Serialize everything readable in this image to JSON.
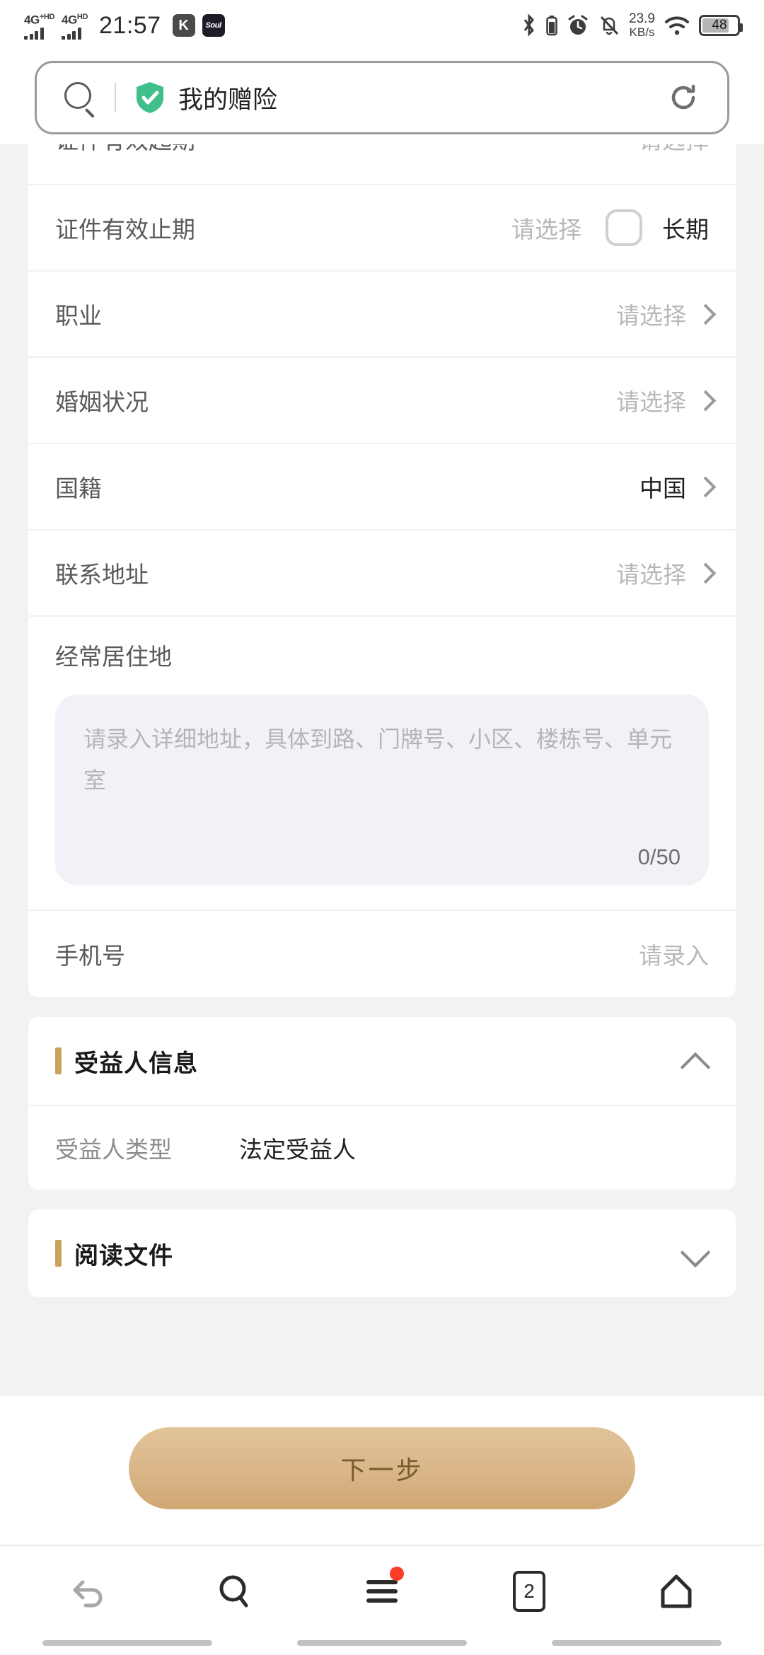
{
  "statusbar": {
    "network_1": "4G",
    "network_1_sup": "+HD",
    "network_2": "4G",
    "network_2_sup": "HD",
    "time": "21:57",
    "app_badge_1": "K",
    "app_badge_2": "Soul",
    "net_speed_value": "23.9",
    "net_speed_unit": "KB/s",
    "battery_level": "48",
    "icons": [
      "bluetooth-icon",
      "battery-small-icon",
      "alarm-icon",
      "mute-icon",
      "wifi-icon"
    ]
  },
  "addressbar": {
    "title": "我的赠险",
    "search_icon": "search-icon",
    "shield_icon": "secure-shield-icon",
    "reload_icon": "reload-icon",
    "shield_color": "#3fc08a"
  },
  "form": {
    "clipped_row": {
      "label": "证件有效起期",
      "value": "请选择"
    },
    "rows": [
      {
        "label": "证件有效止期",
        "value": "请选择",
        "control": "checkbox",
        "checkbox_label": "长期",
        "checked": false
      },
      {
        "label": "职业",
        "value": "请选择",
        "control": "chevron"
      },
      {
        "label": "婚姻状况",
        "value": "请选择",
        "control": "chevron"
      },
      {
        "label": "国籍",
        "value": "中国",
        "control": "chevron",
        "filled": true
      },
      {
        "label": "联系地址",
        "value": "请选择",
        "control": "chevron"
      }
    ],
    "address_block": {
      "label": "经常居住地",
      "placeholder": "请录入详细地址，具体到路、门牌号、小区、楼栋号、单元室",
      "counter": "0/50"
    },
    "phone_row": {
      "label": "手机号",
      "value": "请录入"
    }
  },
  "beneficiary_section": {
    "title": "受益人信息",
    "expanded": true,
    "chevron": "chevron-up-icon",
    "rows": [
      {
        "key": "受益人类型",
        "value": "法定受益人"
      }
    ]
  },
  "documents_section": {
    "title": "阅读文件",
    "expanded": false,
    "chevron": "chevron-down-icon"
  },
  "footer": {
    "next_label": "下一步",
    "accent_color": "#d9b588",
    "accent_text_color": "#7a5a2d"
  },
  "navbar": {
    "items": [
      {
        "name": "back",
        "icon": "back-arrow-icon",
        "label": ""
      },
      {
        "name": "search",
        "icon": "search-icon",
        "label": ""
      },
      {
        "name": "menu",
        "icon": "menu-icon",
        "label": "",
        "badge": true
      },
      {
        "name": "tabs",
        "icon": "tab-count-icon",
        "label": "2"
      },
      {
        "name": "home",
        "icon": "home-icon",
        "label": ""
      }
    ]
  },
  "theme": {
    "section_bar_color": "#c9a25c",
    "page_bg": "#f2f2f2",
    "card_bg": "#ffffff"
  }
}
